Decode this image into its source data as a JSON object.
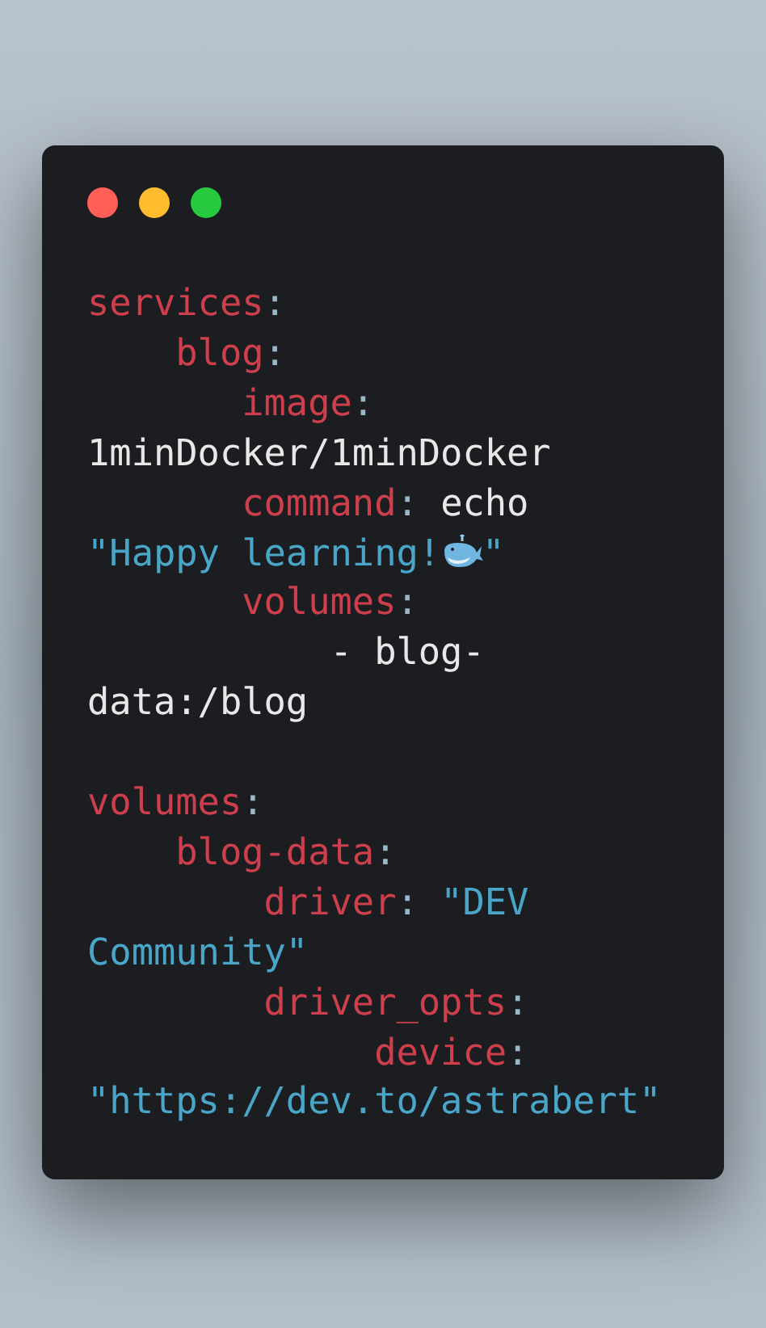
{
  "window_controls": [
    {
      "color": "#ff5f56"
    },
    {
      "color": "#ffbd2e"
    },
    {
      "color": "#27c93f"
    }
  ],
  "sections": [
    {
      "lines": [
        [
          {
            "kind": "key",
            "text": "services"
          },
          {
            "kind": "punct",
            "text": ":"
          }
        ],
        [
          {
            "kind": "key",
            "text": "    blog"
          },
          {
            "kind": "punct",
            "text": ":"
          }
        ],
        [
          {
            "kind": "key",
            "text": "       image"
          },
          {
            "kind": "punct",
            "text": ":"
          }
        ],
        [
          {
            "kind": "plain",
            "text": "1minDocker/1minDocker"
          }
        ],
        [
          {
            "kind": "key",
            "text": "       command"
          },
          {
            "kind": "punct",
            "text": ":"
          },
          {
            "kind": "plain",
            "text": " echo"
          }
        ],
        [
          {
            "kind": "string",
            "text": "\"Happy learning!"
          },
          {
            "kind": "emoji"
          },
          {
            "kind": "string",
            "text": "\""
          }
        ],
        [
          {
            "kind": "key",
            "text": "       volumes"
          },
          {
            "kind": "punct",
            "text": ":"
          }
        ],
        [
          {
            "kind": "plain",
            "text": "           - blog-"
          }
        ],
        [
          {
            "kind": "plain",
            "text": "data:/blog"
          }
        ]
      ]
    },
    {
      "lines": [
        [
          {
            "kind": "key",
            "text": "volumes"
          },
          {
            "kind": "punct",
            "text": ":"
          }
        ],
        [
          {
            "kind": "key",
            "text": "    blog-data"
          },
          {
            "kind": "punct",
            "text": ":"
          }
        ],
        [
          {
            "kind": "key",
            "text": "        driver"
          },
          {
            "kind": "punct",
            "text": ":"
          },
          {
            "kind": "string",
            "text": " \"DEV"
          }
        ],
        [
          {
            "kind": "string",
            "text": "Community\""
          }
        ],
        [
          {
            "kind": "key",
            "text": "        driver_opts"
          },
          {
            "kind": "punct",
            "text": ":"
          }
        ],
        [
          {
            "kind": "key",
            "text": "             device"
          },
          {
            "kind": "punct",
            "text": ":"
          }
        ],
        [
          {
            "kind": "string",
            "text": "\"https://dev.to/astrabert\""
          }
        ]
      ]
    }
  ]
}
